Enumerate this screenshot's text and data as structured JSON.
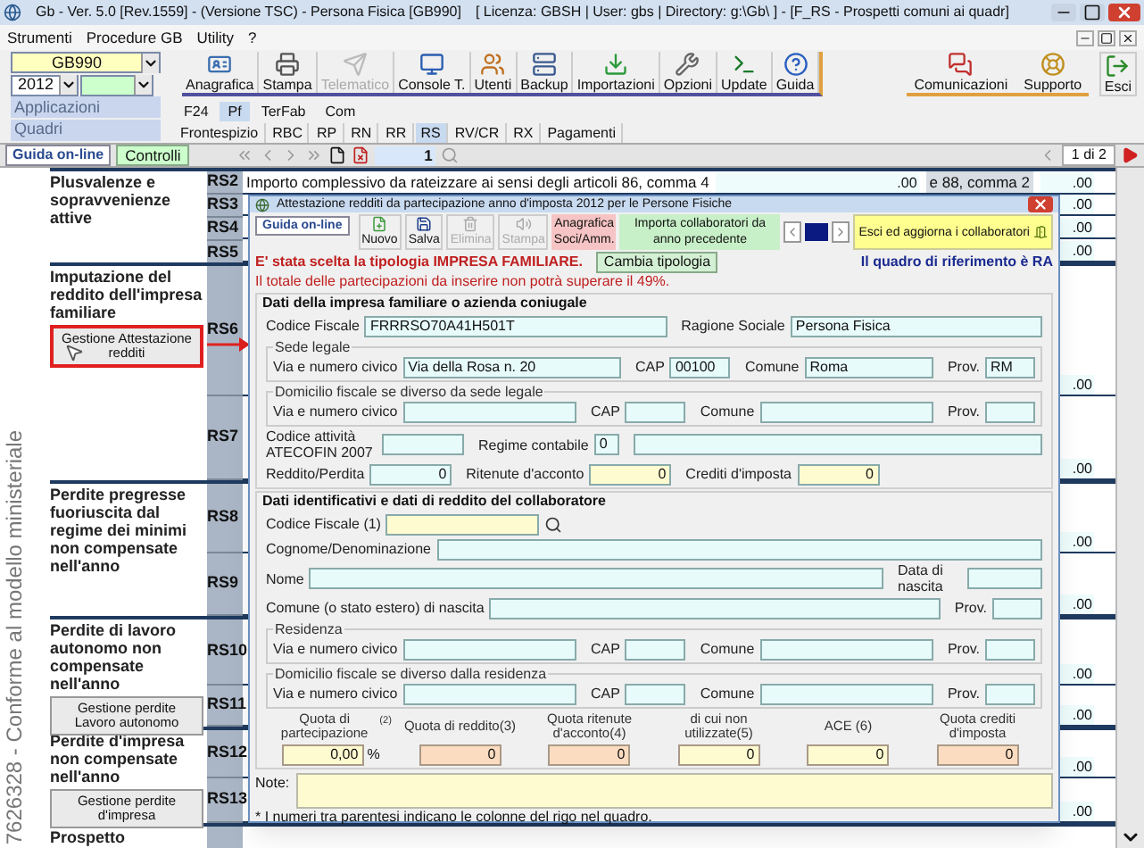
{
  "window": {
    "title": "Gb - Ver. 5.0 [Rev.1559] - (Versione TSC) - Persona Fisica [GB990]",
    "info": "[ Licenza: GBSH | User: gbs | Directory: g:\\Gb\\ ] - [F_RS - Prospetti comuni ai quadr]"
  },
  "menu": [
    "Strumenti",
    "Procedure GB",
    "Utility",
    "?"
  ],
  "selectors": {
    "company": "GB990",
    "year": "2012",
    "applications": "Applicazioni",
    "quadri": "Quadri"
  },
  "toolbar": [
    {
      "label": "Anagrafica",
      "disabled": false
    },
    {
      "label": "Stampa",
      "disabled": false
    },
    {
      "label": "Telematico",
      "disabled": true
    },
    {
      "label": "Console T.",
      "disabled": false
    },
    {
      "label": "Utenti",
      "disabled": false
    },
    {
      "label": "Backup",
      "disabled": false
    },
    {
      "label": "Importazioni",
      "disabled": false
    },
    {
      "label": "Opzioni",
      "disabled": false
    },
    {
      "label": "Update",
      "disabled": false
    },
    {
      "label": "Guida",
      "disabled": false
    }
  ],
  "toolbar_extra": [
    "Comunicazioni",
    "Supporto"
  ],
  "exit_button": "Esci",
  "app_tabs": [
    {
      "label": "F24",
      "selected": false
    },
    {
      "label": "Pf",
      "selected": true
    },
    {
      "label": "TerFab",
      "selected": false
    },
    {
      "label": "Com",
      "selected": false
    }
  ],
  "quadri_tabs": [
    {
      "label": "Frontespizio",
      "selected": false
    },
    {
      "label": "RBC",
      "selected": false
    },
    {
      "label": "RP",
      "selected": false
    },
    {
      "label": "RN",
      "selected": false
    },
    {
      "label": "RR",
      "selected": false
    },
    {
      "label": "RS",
      "selected": true
    },
    {
      "label": "RV/CR",
      "selected": false
    },
    {
      "label": "RX",
      "selected": false
    },
    {
      "label": "Pagamenti",
      "selected": false
    }
  ],
  "navbar": {
    "help": "Guida on-line",
    "checks": "Controlli",
    "record": "1",
    "page": "1 di 2"
  },
  "side_caption": "7626328 - Conforme al modello ministeriale",
  "rs2_row": {
    "text": "Importo complessivo da rateizzare ai sensi degli articoli 86, comma 4",
    "amount": ".00",
    "text_2": "e 88, comma 2",
    "amount_2": ".00"
  },
  "sections": [
    {
      "title": "Plusvalenze e sopravvenienze attive",
      "rows": [
        {
          "code": "RS2"
        },
        {
          "code": "RS3",
          "amount": ".00"
        },
        {
          "code": "RS4",
          "amount": ".00"
        },
        {
          "code": "RS5",
          "amount": ".00"
        }
      ]
    },
    {
      "title": "Imputazione del reddito dell'impresa familiare",
      "button": {
        "label": "Gestione Attestazione redditi",
        "highlighted": true
      },
      "rows": [
        {
          "code": "RS6",
          "amount": ".00"
        },
        {
          "code": "RS7",
          "amount": ".00"
        }
      ]
    },
    {
      "title": "Perdite pregresse fuoriuscita dal regime dei minimi non compensate nell'anno",
      "rows": [
        {
          "code": "RS8",
          "amount": ".00"
        },
        {
          "code": "RS9",
          "amount": ".00"
        }
      ]
    },
    {
      "title": "Perdite di lavoro autonomo non compensate nell'anno",
      "button": {
        "label": "Gestione perdite Lavoro autonomo",
        "highlighted": false
      },
      "rows": [
        {
          "code": "RS10",
          "amount": ".00"
        },
        {
          "code": "RS11",
          "amount": ".00"
        }
      ]
    },
    {
      "title": "Perdite d'impresa non compensate nell'anno",
      "button": {
        "label": "Gestione perdite d'impresa",
        "highlighted": false
      },
      "rows": [
        {
          "code": "RS12",
          "amount": ".00"
        },
        {
          "code": "RS13",
          "amount": ".00"
        }
      ]
    },
    {
      "title": "Prospetto"
    }
  ],
  "dialog": {
    "title": "Attestazione redditi da partecipazione anno d'imposta 2012 per le Persone Fisiche",
    "help": "Guida on-line",
    "buttons": [
      {
        "label": "Nuovo",
        "disabled": false
      },
      {
        "label": "Salva",
        "disabled": false
      },
      {
        "label": "Elimina",
        "disabled": true
      },
      {
        "label": "Stampa",
        "disabled": true
      }
    ],
    "partners_button": "Anagrafica Soci/Amm.",
    "import_button": "Importa collaboratori da anno precedente",
    "exit_button": "Esci ed aggiorna i collaboratori",
    "notice": "E' stata scelta la tipologia IMPRESA FAMILIARE.",
    "change_button": "Cambia tipologia",
    "reference": "Il quadro di riferimento è RA",
    "warning": "Il totale delle partecipazioni da inserire non potrà superare il 49%.",
    "sections": [
      {
        "title": "Dati della impresa familiare o azienda coniugale",
        "items": [
          {
            "kind": "row",
            "fields": [
              {
                "label": "Codice Fiscale",
                "value": "FRRRSO70A41H501T",
                "kind": "text",
                "color": "#e8fbfb"
              },
              {
                "label": "Ragione Sociale",
                "value": "Persona Fisica",
                "kind": "text",
                "color": "#e8fbfb"
              }
            ]
          },
          {
            "kind": "group",
            "title": "Sede legale",
            "fields": [
              {
                "label": "Via e numero civico",
                "value": "Via della Rosa n. 20",
                "kind": "text",
                "color": "#e8fbfb"
              },
              {
                "label": "CAP",
                "value": "00100",
                "kind": "postcode",
                "color": "#e8fbfb"
              },
              {
                "label": "Comune",
                "value": "Roma",
                "kind": "text",
                "color": "#e8fbfb"
              },
              {
                "label": "Prov.",
                "value": "RM",
                "kind": "province",
                "color": "#e8fbfb"
              }
            ]
          },
          {
            "kind": "group",
            "title": "Domicilio fiscale se diverso da sede legale",
            "fields": [
              {
                "label": "Via e numero civico",
                "kind": "text",
                "color": "#e8fbfb"
              },
              {
                "label": "CAP",
                "kind": "postcode",
                "color": "#e8fbfb"
              },
              {
                "label": "Comune",
                "kind": "text",
                "color": "#e8fbfb"
              },
              {
                "label": "Prov.",
                "kind": "province",
                "color": "#e8fbfb"
              }
            ]
          },
          {
            "kind": "row",
            "fields": [
              {
                "label": "Codice attività ATECOFIN 2007",
                "kind": "code",
                "color": "#e8fbfb"
              },
              {
                "label": "Regime contabile",
                "value": "0",
                "kind": "flag",
                "color": "#e8fbfb"
              },
              {
                "kind": "text",
                "color": "#e8fbfb"
              }
            ]
          },
          {
            "kind": "row",
            "fields": [
              {
                "label": "Reddito/Perdita",
                "value": "0",
                "kind": "amount",
                "color": "#e8fbfb"
              },
              {
                "label": "Ritenute d'acconto",
                "value": "0",
                "kind": "amount",
                "color": "#fffbd0"
              },
              {
                "label": "Crediti d'imposta",
                "value": "0",
                "kind": "amount",
                "color": "#fffbd0"
              }
            ]
          }
        ]
      },
      {
        "title": "Dati identificativi e dati di reddito del collaboratore",
        "items": [
          {
            "kind": "row",
            "fields": [
              {
                "label": "Codice Fiscale (1)",
                "kind": "search",
                "color": "#fffbd0"
              }
            ]
          },
          {
            "kind": "row",
            "fields": [
              {
                "label": "Cognome/Denominazione",
                "kind": "text",
                "color": "#e8fbfb"
              }
            ]
          },
          {
            "kind": "row",
            "fields": [
              {
                "label": "Nome",
                "kind": "text",
                "color": "#e8fbfb"
              },
              {
                "label": "Data di nascita",
                "kind": "date",
                "color": "#e8fbfb"
              }
            ]
          },
          {
            "kind": "row",
            "fields": [
              {
                "label": "Comune (o stato estero) di nascita",
                "kind": "text",
                "color": "#e8fbfb"
              },
              {
                "label": "Prov.",
                "kind": "province",
                "color": "#e8fbfb"
              }
            ]
          },
          {
            "kind": "group",
            "title": "Residenza",
            "fields": [
              {
                "label": "Via e numero civico",
                "kind": "text",
                "color": "#e8fbfb"
              },
              {
                "label": "CAP",
                "kind": "postcode",
                "color": "#e8fbfb"
              },
              {
                "label": "Comune",
                "kind": "text",
                "color": "#e8fbfb"
              },
              {
                "label": "Prov.",
                "kind": "province",
                "color": "#e8fbfb"
              }
            ]
          },
          {
            "kind": "group",
            "title": "Domicilio fiscale se diverso dalla residenza",
            "fields": [
              {
                "label": "Via e numero civico",
                "kind": "text",
                "color": "#e8fbfb"
              },
              {
                "label": "CAP",
                "kind": "postcode",
                "color": "#e8fbfb"
              },
              {
                "label": "Comune",
                "kind": "text",
                "color": "#e8fbfb"
              },
              {
                "label": "Prov.",
                "kind": "province",
                "color": "#e8fbfb"
              }
            ]
          },
          {
            "kind": "quotas",
            "fields": [
              {
                "label": "Quota di partecipazione$^{(2)}$",
                "value": "0,00",
                "unit": "%",
                "color": "#fffbd0"
              },
              {
                "label": "Quota di reddito(3)",
                "value": "0",
                "color": "#fcdcc0"
              },
              {
                "label": "Quota ritenute d'acconto(4)",
                "value": "0",
                "color": "#fcdcc0"
              },
              {
                "label": "di cui non utilizzate(5)",
                "value": "0",
                "color": "#fffbd0"
              },
              {
                "label": "ACE (6)",
                "value": "0",
                "color": "#fffbd0"
              },
              {
                "label": "Quota crediti d'imposta",
                "value": "0",
                "color": "#fcdcc0"
              }
            ]
          }
        ]
      }
    ],
    "note_label": "Note:",
    "footnote": "* I numeri tra parentesi indicano le colonne del rigo nel quadro."
  }
}
